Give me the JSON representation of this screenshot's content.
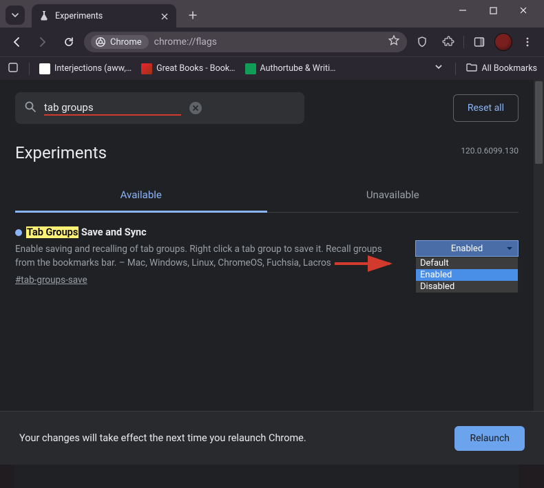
{
  "window": {
    "tab_title": "Experiments"
  },
  "omnibox": {
    "chip_label": "Chrome",
    "url": "chrome://flags"
  },
  "bookmarks": {
    "items": [
      {
        "label": "Interjections (aww,…"
      },
      {
        "label": "Great Books - Book…"
      },
      {
        "label": "Authortube & Writi…"
      }
    ],
    "all_label": "All Bookmarks"
  },
  "flags_page": {
    "search_value": "tab groups",
    "reset_label": "Reset all",
    "heading": "Experiments",
    "version": "120.0.6099.130",
    "tabs": {
      "available": "Available",
      "unavailable": "Unavailable"
    },
    "flag": {
      "title_highlight": "Tab Groups",
      "title_rest": " Save and Sync",
      "description": "Enable saving and recalling of tab groups. Right click a tab group to save it. Recall groups from the bookmarks bar. – Mac, Windows, Linux, ChromeOS, Fuchsia, Lacros",
      "anchor": "#tab-groups-save",
      "selected": "Enabled",
      "options": [
        "Default",
        "Enabled",
        "Disabled"
      ]
    }
  },
  "relaunch": {
    "message": "Your changes will take effect the next time you relaunch Chrome.",
    "button": "Relaunch"
  }
}
